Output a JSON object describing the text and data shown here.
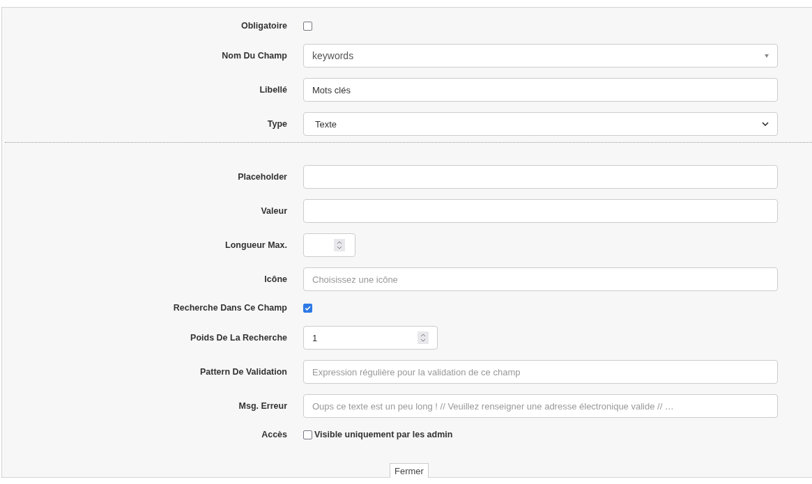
{
  "fields": [
    {
      "kind": "checkbox",
      "label": "Obligatoire",
      "checked": false
    },
    {
      "kind": "combo",
      "label": "Nom Du Champ",
      "value": "keywords"
    },
    {
      "kind": "text",
      "label": "Libellé",
      "value": "Mots clés"
    },
    {
      "kind": "select",
      "label": "Type",
      "value": "Texte"
    },
    {
      "kind": "divider"
    },
    {
      "kind": "text",
      "label": "Placeholder"
    },
    {
      "kind": "text",
      "label": "Valeur"
    },
    {
      "kind": "short-number",
      "label": "Longueur Max."
    },
    {
      "kind": "text",
      "label": "Icône",
      "placeholder": "Choisissez une icône"
    },
    {
      "kind": "checkbox",
      "label": "Recherche Dans Ce Champ",
      "checked": true
    },
    {
      "kind": "number",
      "label": "Poids De La Recherche",
      "value": "1"
    },
    {
      "kind": "text",
      "label": "Pattern De Validation",
      "placeholder": "Expression régulière pour la validation de ce champ"
    },
    {
      "kind": "text",
      "label": "Msg. Erreur",
      "placeholder": "Oups ce texte est un peu long ! // Veuillez renseigner une adresse électronique valide // …"
    },
    {
      "kind": "checkbox",
      "label": "Accès",
      "checked": false,
      "text": "Visible uniquement par les admin"
    }
  ],
  "close_button": "Fermer"
}
